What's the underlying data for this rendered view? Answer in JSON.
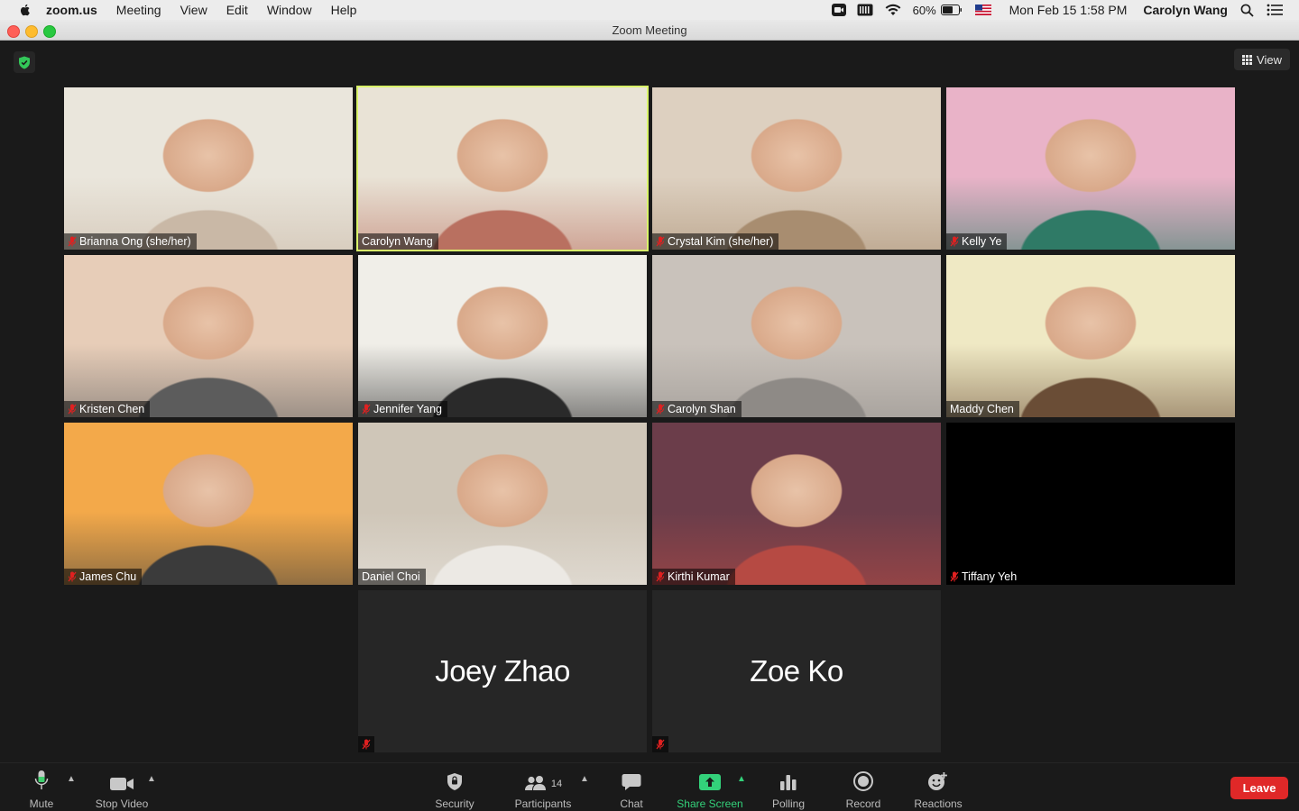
{
  "menubar": {
    "app_name": "zoom.us",
    "menus": [
      "Meeting",
      "View",
      "Edit",
      "Window",
      "Help"
    ],
    "battery": "60%",
    "datetime": "Mon Feb 15  1:58 PM",
    "user": "Carolyn Wang"
  },
  "window": {
    "title": "Zoom Meeting"
  },
  "top": {
    "view_label": "View"
  },
  "participants": [
    {
      "name": "Brianna Ong (she/her)",
      "muted": true,
      "active": false,
      "bg": [
        "#eae6dc",
        "#c9b8a6"
      ]
    },
    {
      "name": "Carolyn Wang",
      "muted": false,
      "active": true,
      "bg": [
        "#e9e3d6",
        "#b97060"
      ]
    },
    {
      "name": "Crystal Kim (she/her)",
      "muted": true,
      "active": false,
      "bg": [
        "#ddd0c0",
        "#a88d70"
      ]
    },
    {
      "name": "Kelly Ye",
      "muted": true,
      "active": false,
      "bg": [
        "#e9b3c8",
        "#2f7a66"
      ]
    },
    {
      "name": "Kristen Chen",
      "muted": true,
      "active": false,
      "bg": [
        "#e7cdb8",
        "#5c5c5c"
      ]
    },
    {
      "name": "Jennifer Yang",
      "muted": true,
      "active": false,
      "bg": [
        "#f0eee8",
        "#2a2a2a"
      ]
    },
    {
      "name": "Carolyn Shan",
      "muted": true,
      "active": false,
      "bg": [
        "#c9c2bb",
        "#8e8a86"
      ]
    },
    {
      "name": "Maddy Chen",
      "muted": false,
      "active": false,
      "bg": [
        "#efe9c4",
        "#6a4d36"
      ]
    },
    {
      "name": "James Chu",
      "muted": true,
      "active": false,
      "bg": [
        "#f3a94a",
        "#3b3b3b"
      ]
    },
    {
      "name": "Daniel Choi",
      "muted": false,
      "active": false,
      "bg": [
        "#cfc6b8",
        "#ece9e4"
      ]
    },
    {
      "name": "Kirthi Kumar",
      "muted": true,
      "active": false,
      "bg": [
        "#6b3d4a",
        "#b64a43"
      ]
    },
    {
      "name": "Tiffany Yeh",
      "muted": true,
      "active": false,
      "bg": [
        "#000000",
        "#000000"
      ]
    }
  ],
  "name_cards": [
    {
      "name": "Joey Zhao",
      "muted": true
    },
    {
      "name": "Zoe Ko",
      "muted": true
    }
  ],
  "toolbar": {
    "mute": "Mute",
    "stop_video": "Stop Video",
    "security": "Security",
    "participants": "Participants",
    "participant_count": "14",
    "chat": "Chat",
    "share_screen": "Share Screen",
    "polling": "Polling",
    "record": "Record",
    "reactions": "Reactions",
    "leave": "Leave"
  },
  "colors": {
    "active_speaker": "#d9f36a",
    "share_green": "#33d17a",
    "leave_red": "#e02828",
    "mute_red": "#e02020"
  }
}
